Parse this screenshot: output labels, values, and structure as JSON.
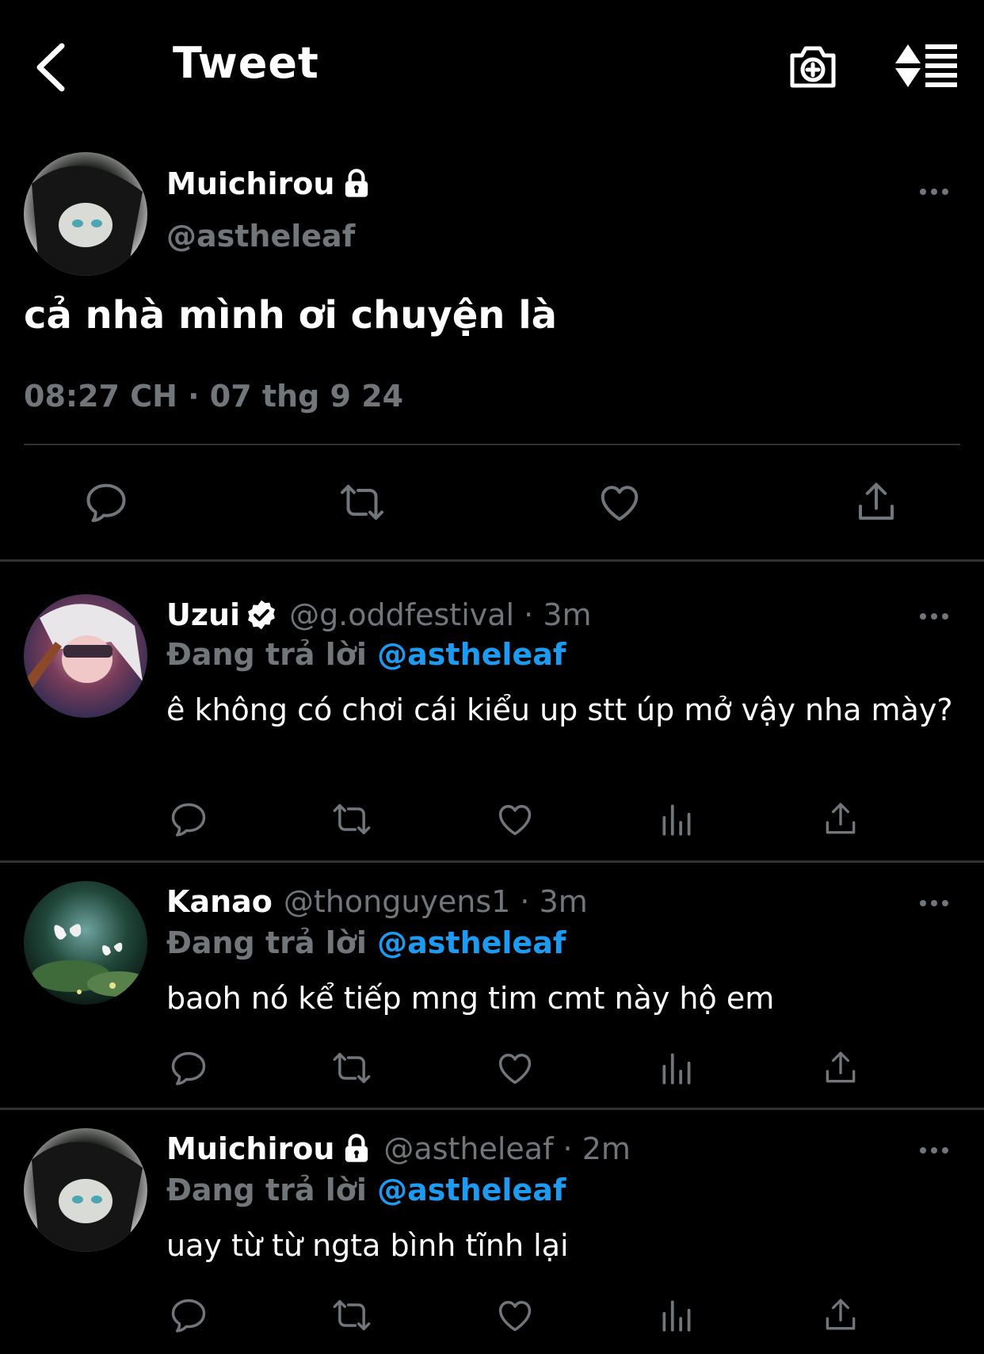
{
  "header": {
    "title": "Tweet",
    "back_icon": "chevron-left-icon",
    "camera_icon": "camera-plus-icon",
    "sort_icon": "sort-list-icon"
  },
  "colors": {
    "background": "#000000",
    "text": "#ffffff",
    "secondary": "#71767b",
    "accent": "#1d9bf0",
    "divider": "#2f3336"
  },
  "main_tweet": {
    "name": "Muichirou",
    "lock_icon": "lock-icon",
    "handle": "@astheleaf",
    "text": "cả nhà mình ơi chuyện là",
    "meta": "08:27 CH · 07 thg 9 24",
    "actions": [
      "reply-icon",
      "retweet-icon",
      "like-icon",
      "share-icon"
    ]
  },
  "replies": [
    {
      "name": "Uzui",
      "badge": "verified-icon",
      "handle": "@g.oddfestival · 3m",
      "replying_prefix": "Đang trả lời",
      "replying_to": "@astheleaf",
      "text": "ê không có chơi cái kiểu up stt úp mở vậy nha mày?"
    },
    {
      "name": "Kanao",
      "handle": "@thonguyens1 · 3m",
      "replying_prefix": "Đang trả lời",
      "replying_to": "@astheleaf",
      "text": "baoh nó kể tiếp mng tim cmt này hộ em"
    },
    {
      "name": "Muichirou",
      "badge": "lock-icon",
      "handle": "@astheleaf · 2m",
      "replying_prefix": "Đang trả lời",
      "replying_to": "@astheleaf",
      "text": "uay từ từ ngta bình tĩnh lại"
    }
  ]
}
